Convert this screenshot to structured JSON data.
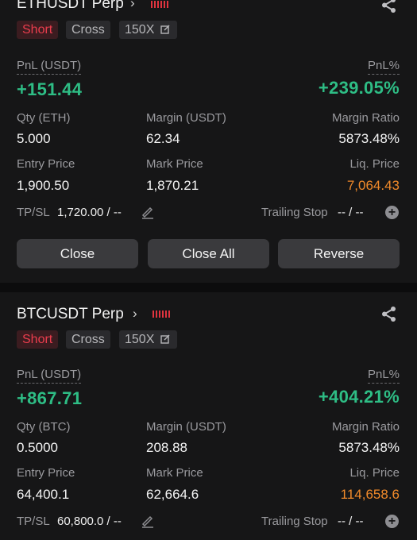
{
  "positions": [
    {
      "symbol": "ETHUSDT Perp",
      "side": "Short",
      "margin_mode": "Cross",
      "leverage": "150X",
      "pnl_label": "PnL (USDT)",
      "pnl_value": "+151.44",
      "pnl_pct_label": "PnL%",
      "pnl_pct_value": "+239.05%",
      "qty_label": "Qty (ETH)",
      "qty_value": "5.000",
      "margin_label": "Margin (USDT)",
      "margin_value": "62.34",
      "margin_ratio_label": "Margin Ratio",
      "margin_ratio_value": "5873.48%",
      "entry_label": "Entry Price",
      "entry_value": "1,900.50",
      "mark_label": "Mark Price",
      "mark_value": "1,870.21",
      "liq_label": "Liq. Price",
      "liq_value": "7,064.43",
      "tpsl_label": "TP/SL",
      "tpsl_value": "1,720.00 / --",
      "trailing_label": "Trailing Stop",
      "trailing_value": "-- / --",
      "btn_close": "Close",
      "btn_close_all": "Close All",
      "btn_reverse": "Reverse"
    },
    {
      "symbol": "BTCUSDT Perp",
      "side": "Short",
      "margin_mode": "Cross",
      "leverage": "150X",
      "pnl_label": "PnL (USDT)",
      "pnl_value": "+867.71",
      "pnl_pct_label": "PnL%",
      "pnl_pct_value": "+404.21%",
      "qty_label": "Qty (BTC)",
      "qty_value": "0.5000",
      "margin_label": "Margin (USDT)",
      "margin_value": "208.88",
      "margin_ratio_label": "Margin Ratio",
      "margin_ratio_value": "5873.48%",
      "entry_label": "Entry Price",
      "entry_value": "64,400.1",
      "mark_label": "Mark Price",
      "mark_value": "62,664.6",
      "liq_label": "Liq. Price",
      "liq_value": "114,658.6",
      "tpsl_label": "TP/SL",
      "tpsl_value": "60,800.0 / --",
      "trailing_label": "Trailing Stop",
      "trailing_value": "-- / --"
    }
  ],
  "colors": {
    "profit": "#2ebd85",
    "short": "#ea3d4d",
    "liquidation": "#f18a2a",
    "background": "#161617"
  },
  "icons": {
    "share": "share-icon",
    "edit": "edit-icon",
    "pencil": "pencil-icon",
    "add": "plus-circle-icon",
    "chevron": "chevron-right-icon"
  }
}
